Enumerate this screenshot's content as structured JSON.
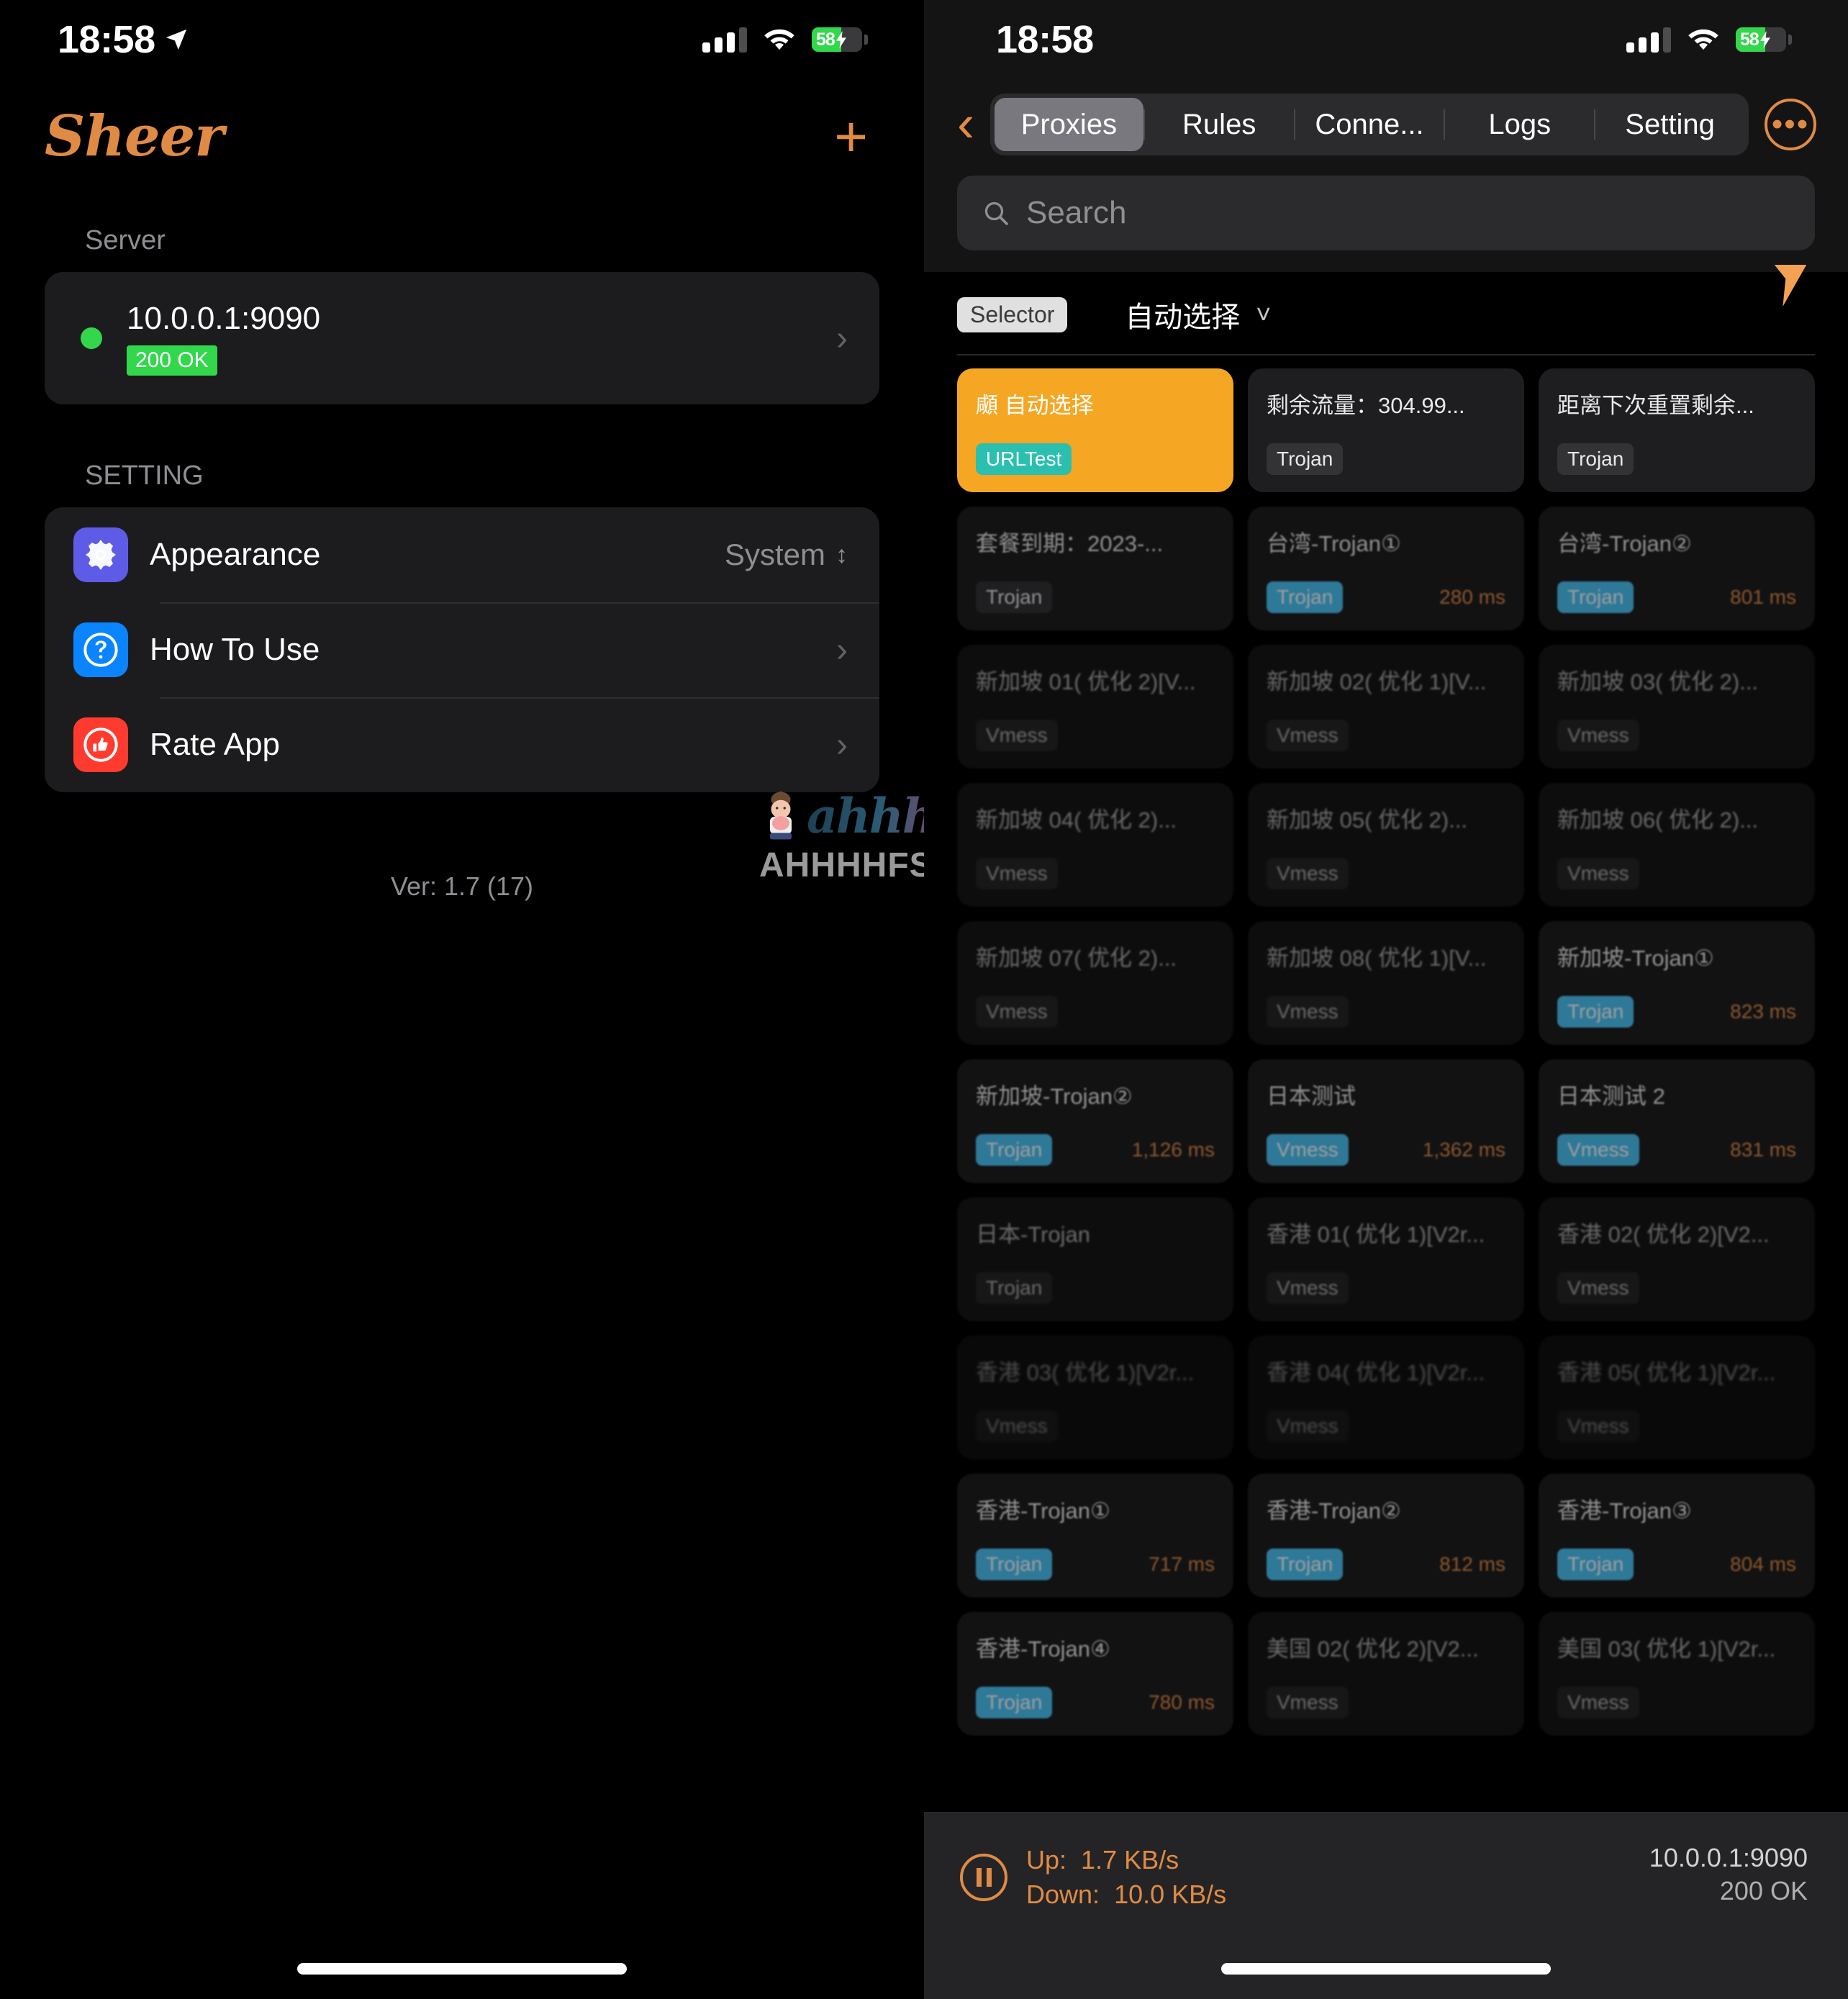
{
  "status_bar": {
    "time": "18:58",
    "battery_pct": "58",
    "location_icon": "location-arrow-icon",
    "cellular_icon": "cellular-bars-icon",
    "wifi_icon": "wifi-icon",
    "battery_icon": "battery-charging-icon"
  },
  "left": {
    "app_name": "Sheer",
    "add_button": "+",
    "server_section_label": "Server",
    "server": {
      "address": "10.0.0.1:9090",
      "status_badge": "200 OK",
      "status_dot_color": "#32d74b",
      "chevron": "›"
    },
    "setting_section_label": "SETTING",
    "settings": [
      {
        "label": "Appearance",
        "value": "System",
        "icon": "gear-icon",
        "icon_color": "#5e5ce6",
        "accessory": "updown-chevrons"
      },
      {
        "label": "How To Use",
        "value": "",
        "icon": "question-mark-icon",
        "icon_color": "#0a84ff",
        "accessory": "chevron-right"
      },
      {
        "label": "Rate App",
        "value": "",
        "icon": "thumbs-up-icon",
        "icon_color": "#ff3b30",
        "accessory": "chevron-right"
      }
    ],
    "version": "Ver: 1.7 (17)",
    "watermark": {
      "script": "ahhhhfs",
      "domain": "AHHHHFS.COM"
    }
  },
  "right": {
    "back_icon": "chevron-left-icon",
    "tabs": [
      {
        "label": "Proxies",
        "active": true
      },
      {
        "label": "Rules",
        "active": false
      },
      {
        "label": "Conne...",
        "active": false
      },
      {
        "label": "Logs",
        "active": false
      },
      {
        "label": "Setting",
        "active": false
      }
    ],
    "more_button": "•••",
    "search": {
      "placeholder": "Search",
      "value": "",
      "icon": "search-icon"
    },
    "selector": {
      "tag": "Selector",
      "icon": "recycle-icon",
      "name": "自动选择",
      "caret": "⌄"
    },
    "proxies": [
      {
        "name": "自动选择",
        "type": "URLTest",
        "type_style": "teal",
        "delay": "",
        "selected": true,
        "icon": "recycle-icon",
        "dim": 0
      },
      {
        "name": "剩余流量：304.99...",
        "type": "Trojan",
        "type_style": "grey",
        "delay": "",
        "selected": false,
        "dim": 0
      },
      {
        "name": "距离下次重置剩余...",
        "type": "Trojan",
        "type_style": "grey",
        "delay": "",
        "selected": false,
        "dim": 0
      },
      {
        "name": "套餐到期：2023-...",
        "type": "Trojan",
        "type_style": "grey",
        "delay": "",
        "selected": false,
        "dim": 1
      },
      {
        "name": "台湾-Trojan①",
        "type": "Trojan",
        "type_style": "blue",
        "delay": "280 ms",
        "selected": false,
        "dim": 1
      },
      {
        "name": "台湾-Trojan②",
        "type": "Trojan",
        "type_style": "blue",
        "delay": "801 ms",
        "selected": false,
        "dim": 1
      },
      {
        "name": "新加坡 01( 优化 2)[V...",
        "type": "Vmess",
        "type_style": "grey",
        "delay": "",
        "selected": false,
        "dim": 2
      },
      {
        "name": "新加坡 02( 优化 1)[V...",
        "type": "Vmess",
        "type_style": "grey",
        "delay": "",
        "selected": false,
        "dim": 2
      },
      {
        "name": "新加坡 03( 优化 2)...",
        "type": "Vmess",
        "type_style": "grey",
        "delay": "",
        "selected": false,
        "dim": 2
      },
      {
        "name": "新加坡 04( 优化 2)...",
        "type": "Vmess",
        "type_style": "grey",
        "delay": "",
        "selected": false,
        "dim": 2
      },
      {
        "name": "新加坡 05( 优化 2)...",
        "type": "Vmess",
        "type_style": "grey",
        "delay": "",
        "selected": false,
        "dim": 2
      },
      {
        "name": "新加坡 06( 优化 2)...",
        "type": "Vmess",
        "type_style": "grey",
        "delay": "",
        "selected": false,
        "dim": 2
      },
      {
        "name": "新加坡 07( 优化 2)...",
        "type": "Vmess",
        "type_style": "grey",
        "delay": "",
        "selected": false,
        "dim": 2
      },
      {
        "name": "新加坡 08( 优化 1)[V...",
        "type": "Vmess",
        "type_style": "grey",
        "delay": "",
        "selected": false,
        "dim": 2
      },
      {
        "name": "新加坡-Trojan①",
        "type": "Trojan",
        "type_style": "blue",
        "delay": "823 ms",
        "selected": false,
        "dim": 1
      },
      {
        "name": "新加坡-Trojan②",
        "type": "Trojan",
        "type_style": "blue",
        "delay": "1,126 ms",
        "selected": false,
        "dim": 1
      },
      {
        "name": "日本测试",
        "type": "Vmess",
        "type_style": "blue",
        "delay": "1,362 ms",
        "selected": false,
        "dim": 1
      },
      {
        "name": "日本测试 2",
        "type": "Vmess",
        "type_style": "blue",
        "delay": "831 ms",
        "selected": false,
        "dim": 1
      },
      {
        "name": "日本-Trojan",
        "type": "Trojan",
        "type_style": "grey",
        "delay": "",
        "selected": false,
        "dim": 2
      },
      {
        "name": "香港 01( 优化 1)[V2r...",
        "type": "Vmess",
        "type_style": "grey",
        "delay": "",
        "selected": false,
        "dim": 2
      },
      {
        "name": "香港 02( 优化 2)[V2...",
        "type": "Vmess",
        "type_style": "grey",
        "delay": "",
        "selected": false,
        "dim": 2
      },
      {
        "name": "香港 03( 优化 1)[V2r...",
        "type": "Vmess",
        "type_style": "grey",
        "delay": "",
        "selected": false,
        "dim": 3
      },
      {
        "name": "香港 04( 优化 1)[V2r...",
        "type": "Vmess",
        "type_style": "grey",
        "delay": "",
        "selected": false,
        "dim": 3
      },
      {
        "name": "香港 05( 优化 1)[V2r...",
        "type": "Vmess",
        "type_style": "grey",
        "delay": "",
        "selected": false,
        "dim": 3
      },
      {
        "name": "香港-Trojan①",
        "type": "Trojan",
        "type_style": "blue",
        "delay": "717 ms",
        "selected": false,
        "dim": 1
      },
      {
        "name": "香港-Trojan②",
        "type": "Trojan",
        "type_style": "blue",
        "delay": "812 ms",
        "selected": false,
        "dim": 1
      },
      {
        "name": "香港-Trojan③",
        "type": "Trojan",
        "type_style": "blue",
        "delay": "804 ms",
        "selected": false,
        "dim": 1
      },
      {
        "name": "香港-Trojan④",
        "type": "Trojan",
        "type_style": "blue",
        "delay": "780 ms",
        "selected": false,
        "dim": 1
      },
      {
        "name": "美国 02( 优化 2)[V2...",
        "type": "Vmess",
        "type_style": "grey",
        "delay": "",
        "selected": false,
        "dim": 2
      },
      {
        "name": "美国 03( 优化 1)[V2r...",
        "type": "Vmess",
        "type_style": "grey",
        "delay": "",
        "selected": false,
        "dim": 2
      }
    ],
    "bottom_bar": {
      "pause_icon": "pause-circle-icon",
      "up_label": "Up:",
      "up_value": "1.7 KB/s",
      "down_label": "Down:",
      "down_value": "10.0 KB/s",
      "address": "10.0.0.1:9090",
      "status": "200 OK"
    }
  },
  "colors": {
    "accent_orange": "#e08b45",
    "selected_card": "#f5a623",
    "status_green": "#32d74b",
    "type_blue": "#4dc3f5",
    "type_teal": "#2bbfb0"
  }
}
